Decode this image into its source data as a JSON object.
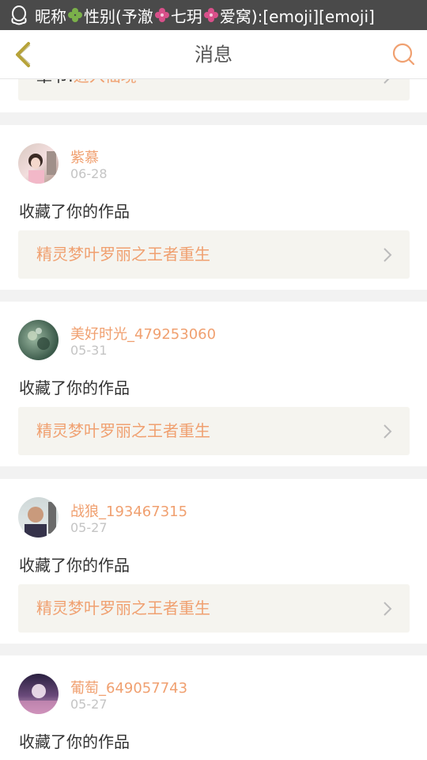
{
  "status_bar": {
    "icon": "qq-penguin-icon",
    "segments": [
      "昵称",
      "性别(予澈",
      "七玥",
      "爱窝):[emoji][emoji]"
    ],
    "emoji_icons": [
      "clover-icon",
      "flower-icon",
      "flower-icon"
    ]
  },
  "navbar": {
    "title": "消息",
    "back_icon": "chevron-left-icon",
    "search_icon": "search-icon",
    "accent_color": "#f0a070"
  },
  "partial_card": {
    "label": "章节:",
    "work_title": "进入仙境"
  },
  "messages": [
    {
      "user": "紫慕",
      "date": "06-28",
      "action": "收藏了你的作品",
      "work_title": "精灵梦叶罗丽之王者重生"
    },
    {
      "user": "美好时光_479253060",
      "date": "05-31",
      "action": "收藏了你的作品",
      "work_title": "精灵梦叶罗丽之王者重生"
    },
    {
      "user": "战狼_193467315",
      "date": "05-27",
      "action": "收藏了你的作品",
      "work_title": "精灵梦叶罗丽之王者重生"
    },
    {
      "user": "葡萄_649057743",
      "date": "05-27",
      "action": "收藏了你的作品"
    }
  ]
}
